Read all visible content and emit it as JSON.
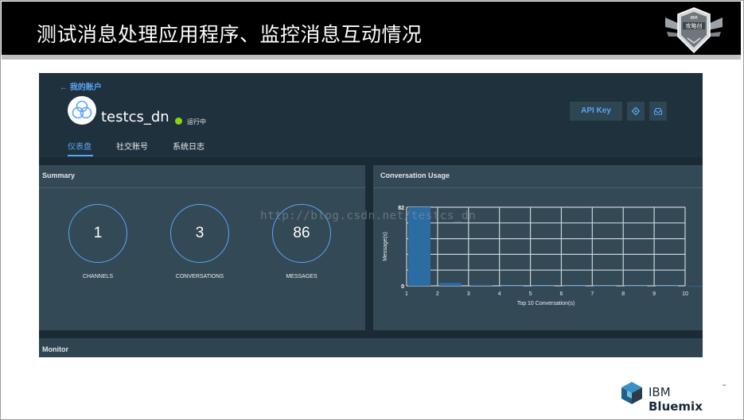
{
  "slide": {
    "title": "测试消息处理应用程序、监控消息互动情况",
    "footer_logo_text_ibm": "IBM",
    "footer_logo_text_brand": "Bluemix",
    "footer_logo_tm": "™"
  },
  "badge": {
    "text_lines": [
      "IBM",
      "攻略创"
    ]
  },
  "app": {
    "back_label": "← 我的账户",
    "name": "testcs_dn",
    "status": "运行中",
    "status_color": "#8cd211",
    "api_key_label": "API Key",
    "icons": [
      "settings-icon",
      "inbox-icon"
    ],
    "tabs": [
      {
        "label": "仪表盘",
        "active": true
      },
      {
        "label": "社交账号",
        "active": false
      },
      {
        "label": "系统日志",
        "active": false
      }
    ]
  },
  "summary": {
    "title": "Summary",
    "stats": [
      {
        "value": "1",
        "label": "CHANNELS"
      },
      {
        "value": "3",
        "label": "CONVERSATIONS"
      },
      {
        "value": "86",
        "label": "MESSAGES"
      }
    ]
  },
  "usage": {
    "title": "Conversation Usage"
  },
  "monitor": {
    "title": "Monitor"
  },
  "watermark": "http://blog.csdn.net/testcs_dn",
  "accent_color": "#5aa5f5",
  "chart_data": {
    "type": "bar",
    "categories": [
      "1",
      "2",
      "3",
      "4",
      "5",
      "6",
      "7",
      "8",
      "9",
      "10"
    ],
    "values": [
      82,
      3,
      1,
      0,
      0,
      0,
      0,
      0,
      0,
      0
    ],
    "xlabel": "Top 10 Conversation(s)",
    "ylabel": "Message(s)",
    "ylim": [
      0,
      82
    ],
    "y_ticks": [
      "0",
      "82"
    ],
    "grid": true,
    "bar_color": "#2b6ca3"
  }
}
